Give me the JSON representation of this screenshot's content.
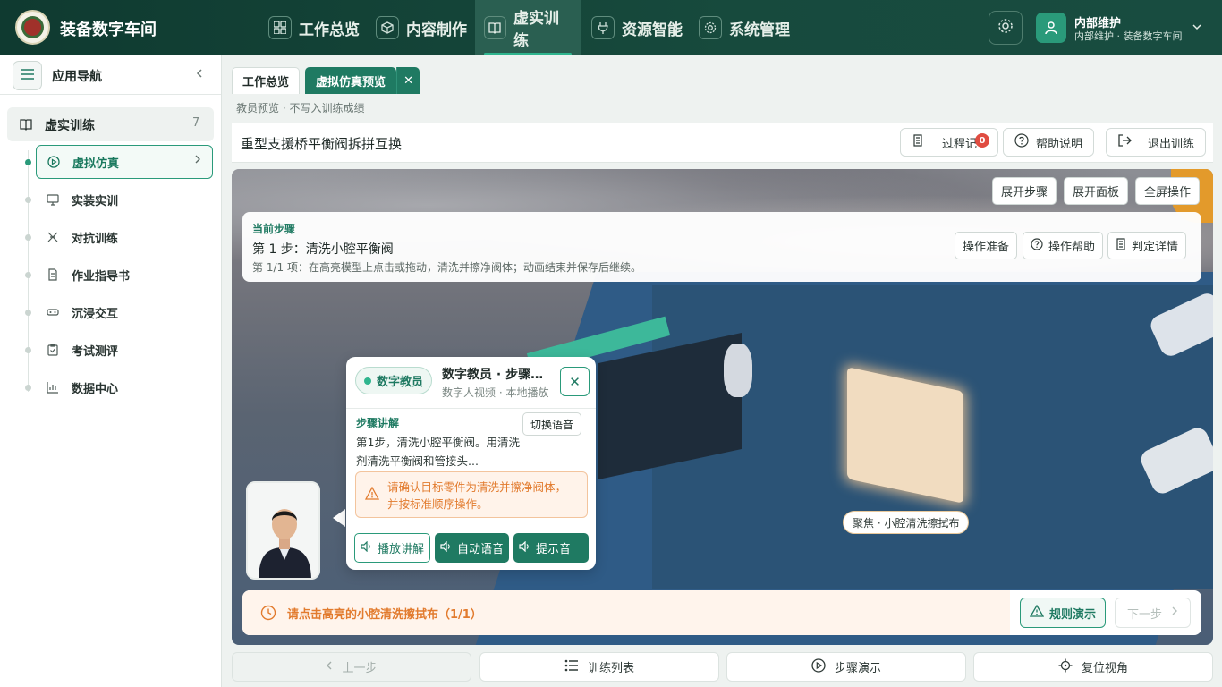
{
  "app": {
    "title": "装备数字车间"
  },
  "topnav": [
    {
      "label": "工作总览",
      "icon": "grid-icon"
    },
    {
      "label": "内容制作",
      "icon": "cube-icon"
    },
    {
      "label": "虚实训练",
      "icon": "book-icon"
    },
    {
      "label": "资源智能",
      "icon": "plug-icon"
    },
    {
      "label": "系统管理",
      "icon": "gear-icon"
    }
  ],
  "user": {
    "name": "内部维护",
    "sub": "内部维护 · 装备数字车间"
  },
  "sidebar": {
    "title": "应用导航",
    "group": {
      "label": "虚实训练",
      "count": "7"
    },
    "items": [
      {
        "label": "虚拟仿真"
      },
      {
        "label": "实装实训"
      },
      {
        "label": "对抗训练"
      },
      {
        "label": "作业指导书"
      },
      {
        "label": "沉浸交互"
      },
      {
        "label": "考试测评"
      },
      {
        "label": "数据中心"
      }
    ]
  },
  "tabs": [
    {
      "label": "工作总览"
    },
    {
      "label": "虚拟仿真预览"
    }
  ],
  "hint": "教员预览 · 不写入训练成绩",
  "training": {
    "title": "重型支援桥平衡阀拆拼互换",
    "buttons": {
      "process": "过程记",
      "process_badge": "0",
      "help": "帮助说明",
      "exit": "退出训练"
    }
  },
  "scene": {
    "top_buttons": [
      "展开步骤",
      "展开面板",
      "全屏操作"
    ],
    "focus_label": "聚焦 · 小腔清洗擦拭布"
  },
  "step": {
    "label": "当前步骤",
    "title": "第 1 步：清洗小腔平衡阀",
    "desc": "第 1/1 项：在高亮模型上点击或拖动，清洗并擦净阀体；动画结束并保存后继续。",
    "buttons": {
      "prepare": "操作准备",
      "help": "操作帮助",
      "detail": "判定详情"
    }
  },
  "teacher": {
    "tag": "数字教员",
    "name": "数字教员 · 步骤讲解",
    "sub": "数字人视频 · 本地播放",
    "section": "步骤讲解",
    "switch_voice": "切换语音",
    "text": "第1步，清洗小腔平衡阀。用清洗剂清洗平衡阀和管接头...",
    "warning": "请确认目标零件为清洗并擦净阀体，并按标准顺序操作。",
    "buttons": {
      "play": "播放讲解",
      "auto": "自动语音",
      "tone": "提示音"
    }
  },
  "prompt": {
    "text": "请点击高亮的小腔清洗擦拭布（1/1）",
    "demo": "规则演示",
    "next": "下一步"
  },
  "footer": {
    "prev": "上一步",
    "list": "训练列表",
    "demo": "步骤演示",
    "reset": "复位视角"
  },
  "colors": {
    "brand": "#174a3d",
    "accent": "#1f7a62",
    "warning": "#e27b2e",
    "badge": "#e04c41"
  }
}
